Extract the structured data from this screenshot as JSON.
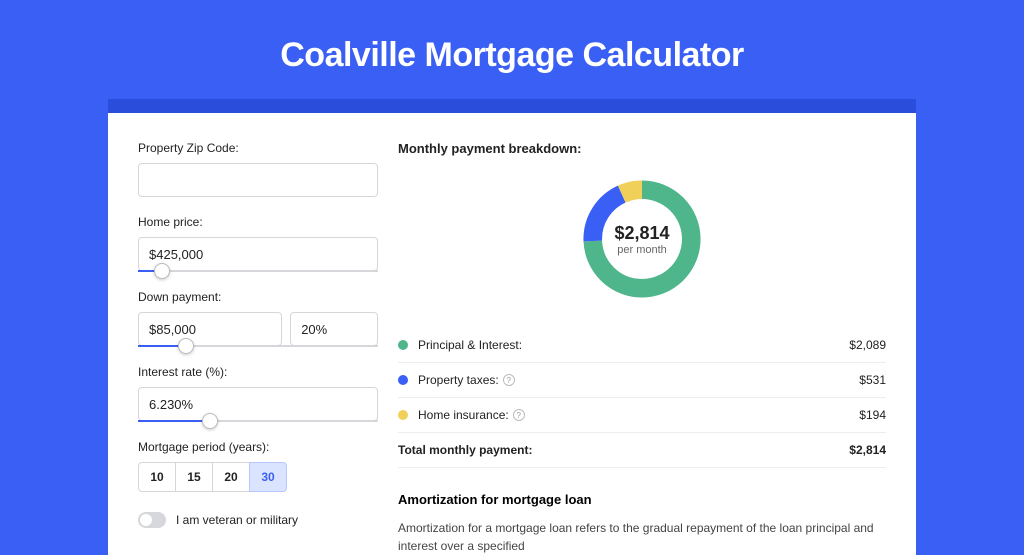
{
  "title": "Coalville Mortgage Calculator",
  "form": {
    "zip": {
      "label": "Property Zip Code:",
      "value": ""
    },
    "price": {
      "label": "Home price:",
      "value": "$425,000",
      "slider_pct": 10
    },
    "down": {
      "label": "Down payment:",
      "amount": "$85,000",
      "percent": "20%",
      "slider_pct": 20
    },
    "rate": {
      "label": "Interest rate (%):",
      "value": "6.230%",
      "slider_pct": 30
    },
    "period": {
      "label": "Mortgage period (years):",
      "options": [
        "10",
        "15",
        "20",
        "30"
      ],
      "selected": "30"
    },
    "veteran": {
      "label": "I am veteran or military",
      "on": false
    }
  },
  "breakdown": {
    "title": "Monthly payment breakdown:",
    "total_amount": "$2,814",
    "total_sub": "per month",
    "items": [
      {
        "label": "Principal & Interest:",
        "value": "$2,089",
        "color": "#4fb58a",
        "info": false
      },
      {
        "label": "Property taxes:",
        "value": "$531",
        "color": "#3a5ff5",
        "info": true
      },
      {
        "label": "Home insurance:",
        "value": "$194",
        "color": "#f1d05a",
        "info": true
      }
    ],
    "total_row": {
      "label": "Total monthly payment:",
      "value": "$2,814"
    }
  },
  "chart_data": {
    "type": "pie",
    "title": "Monthly payment breakdown",
    "series": [
      {
        "name": "Principal & Interest",
        "value": 2089
      },
      {
        "name": "Property taxes",
        "value": 531
      },
      {
        "name": "Home insurance",
        "value": 194
      }
    ],
    "total": 2814
  },
  "amort": {
    "title": "Amortization for mortgage loan",
    "text": "Amortization for a mortgage loan refers to the gradual repayment of the loan principal and interest over a specified"
  }
}
